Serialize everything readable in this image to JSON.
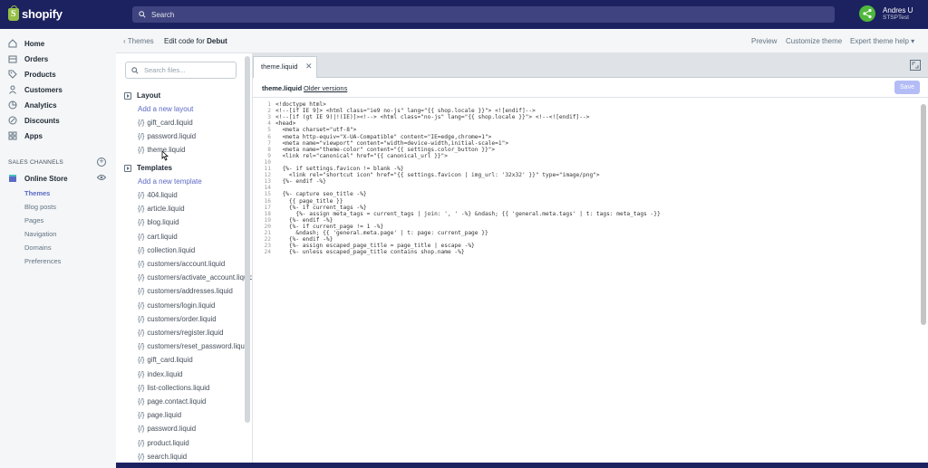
{
  "brand": {
    "name": "shopify",
    "logo_letter": "S"
  },
  "search": {
    "placeholder": "Search"
  },
  "user": {
    "name": "Andres U",
    "store": "STSPTest"
  },
  "nav": {
    "items": [
      {
        "label": "Home",
        "icon": "home-icon"
      },
      {
        "label": "Orders",
        "icon": "orders-icon"
      },
      {
        "label": "Products",
        "icon": "tag-icon"
      },
      {
        "label": "Customers",
        "icon": "person-icon"
      },
      {
        "label": "Analytics",
        "icon": "chart-icon"
      },
      {
        "label": "Discounts",
        "icon": "discount-icon"
      },
      {
        "label": "Apps",
        "icon": "apps-icon"
      }
    ],
    "sales_channels_label": "SALES CHANNELS",
    "online_store_label": "Online Store",
    "sub_items": [
      "Themes",
      "Blog posts",
      "Pages",
      "Navigation",
      "Domains",
      "Preferences"
    ]
  },
  "header": {
    "back_label": "Themes",
    "edit_prefix": "Edit code for",
    "theme_name": "Debut",
    "links": [
      "Preview",
      "Customize theme",
      "Expert theme help"
    ]
  },
  "file_browser": {
    "search_placeholder": "Search files...",
    "layout": {
      "title": "Layout",
      "add_label": "Add a new layout",
      "files": [
        "gift_card.liquid",
        "password.liquid",
        "theme.liquid"
      ]
    },
    "templates": {
      "title": "Templates",
      "add_label": "Add a new template",
      "files": [
        "404.liquid",
        "article.liquid",
        "blog.liquid",
        "cart.liquid",
        "collection.liquid",
        "customers/account.liquid",
        "customers/activate_account.liquid",
        "customers/addresses.liquid",
        "customers/login.liquid",
        "customers/order.liquid",
        "customers/register.liquid",
        "customers/reset_password.liquid",
        "gift_card.liquid",
        "index.liquid",
        "list-collections.liquid",
        "page.contact.liquid",
        "page.liquid",
        "password.liquid",
        "product.liquid",
        "search.liquid"
      ]
    },
    "file_prefix": "{/}"
  },
  "editor": {
    "tab_label": "theme.liquid",
    "file_name": "theme.liquid",
    "older_versions": "Older versions",
    "save_label": "Save",
    "lines": [
      "<!doctype html>",
      "<!--[if IE 9]> <html class=\"ie9 no-js\" lang=\"{{ shop.locale }}\"> <![endif]-->",
      "<!--[if (gt IE 9)|!(IE)]><!--> <html class=\"no-js\" lang=\"{{ shop.locale }}\"> <!--<![endif]-->",
      "<head>",
      "  <meta charset=\"utf-8\">",
      "  <meta http-equiv=\"X-UA-Compatible\" content=\"IE=edge,chrome=1\">",
      "  <meta name=\"viewport\" content=\"width=device-width,initial-scale=1\">",
      "  <meta name=\"theme-color\" content=\"{{ settings.color_button }}\">",
      "  <link rel=\"canonical\" href=\"{{ canonical_url }}\">",
      "",
      "  {%- if settings.favicon != blank -%}",
      "    <link rel=\"shortcut icon\" href=\"{{ settings.favicon | img_url: '32x32' }}\" type=\"image/png\">",
      "  {%- endif -%}",
      "",
      "  {%- capture seo_title -%}",
      "    {{ page_title }}",
      "    {%- if current_tags -%}",
      "      {%- assign meta_tags = current_tags | join: ', ' -%} &ndash; {{ 'general.meta.tags' | t: tags: meta_tags -}}",
      "    {%- endif -%}",
      "    {%- if current_page != 1 -%}",
      "      &ndash; {{ 'general.meta.page' | t: page: current_page }}",
      "    {%- endif -%}",
      "    {%- assign escaped_page_title = page_title | escape -%}",
      "    {%- unless escaped_page_title contains shop.name -%}"
    ]
  }
}
